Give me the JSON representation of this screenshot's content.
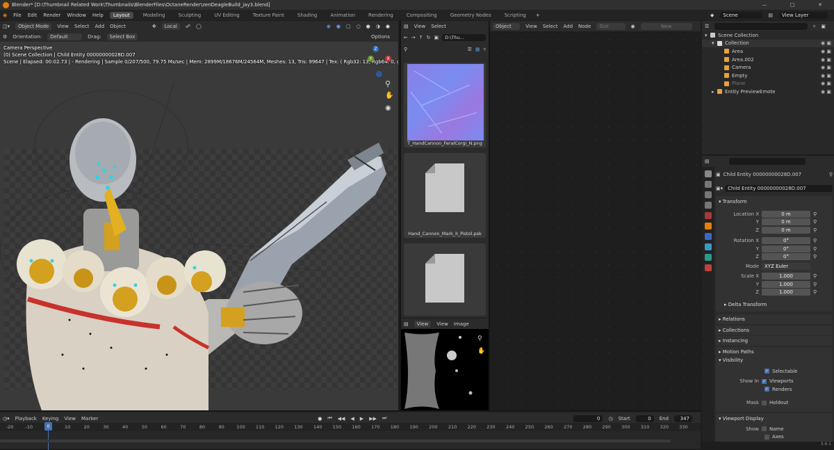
{
  "title_bar": {
    "title": "Blender* [D:\\Thumbnail Related Work\\Thumbnails\\BlenderFiles\\OctaneRender\\zenDeagleBuild_jay3.blend]"
  },
  "menu": [
    "File",
    "Edit",
    "Render",
    "Window",
    "Help"
  ],
  "workspaces": [
    "Layout",
    "Modeling",
    "Sculpting",
    "UV Editing",
    "Texture Paint",
    "Shading",
    "Animation",
    "Rendering",
    "Compositing",
    "Geometry Nodes",
    "Scripting"
  ],
  "active_workspace": "Layout",
  "scene": {
    "name": "Scene",
    "view_layer": "View Layer"
  },
  "viewport": {
    "mode": "Object Mode",
    "menus": [
      "View",
      "Select",
      "Add",
      "Object"
    ],
    "transform_orientation": "Local",
    "orientation_label": "Orientation:",
    "orientation_value": "Default",
    "drag_label": "Drag:",
    "drag_value": "Select Box",
    "options": "Options",
    "overlay_line1": "Camera Perspective",
    "overlay_line2": "(0) Scene Collection | Child Entity 00000000028D.007",
    "overlay_line3": "Scene | Elapsed: 00:02.73 |  - Rendering | Sample 0/207/500, 79.75 Ms/sec | Mem: 2899M/18676M/24564M, Meshes: 13, Tris: 99647 | Tex: ( Rgb32: 13, Rgb64: 0, grey8: 0, g... 16:... | No ne"
  },
  "file_browser": {
    "menus": [
      "View",
      "Select"
    ],
    "path": "D:\\Thu...",
    "files": [
      "T_HandCannon_FeralCorgi_N.png",
      "Hand_Cannon_Mark_II_Pistol.psk",
      ""
    ]
  },
  "image_viewer": {
    "menus": [
      "View",
      "View",
      "Image"
    ]
  },
  "node_editor": {
    "menus": [
      "Object",
      "View",
      "Select",
      "Add",
      "Node"
    ],
    "slot": "Slot",
    "new_label": "New"
  },
  "outliner": {
    "rows": [
      {
        "label": "Scene Collection",
        "indent": 0,
        "color": "#c9c9c9"
      },
      {
        "label": "Collection",
        "indent": 1,
        "color": "#dddddd"
      },
      {
        "label": "Area",
        "indent": 2,
        "color": "#e8a040"
      },
      {
        "label": "Area.002",
        "indent": 2,
        "color": "#e8a040"
      },
      {
        "label": "Camera",
        "indent": 2,
        "color": "#e8a040"
      },
      {
        "label": "Empty",
        "indent": 2,
        "color": "#e8a040"
      },
      {
        "label": "Plane",
        "indent": 2,
        "color": "#e8a040"
      },
      {
        "label": "Entity PreviewEmote",
        "indent": 1,
        "color": "#e8a040"
      }
    ]
  },
  "properties": {
    "object_name": "Child Entity 00000000028D.007",
    "datablock_name": "Child Entity 00000000028D.007",
    "transform_title": "Transform",
    "location": {
      "label": "Location X",
      "x": "0 m",
      "y": "0 m",
      "z": "0 m"
    },
    "rotation": {
      "label": "Rotation X",
      "x": "0°",
      "y": "0°",
      "z": "0°"
    },
    "mode_label": "Mode",
    "mode_value": "XYZ Euler",
    "scale": {
      "label": "Scale X",
      "x": "1.000",
      "y": "1.000",
      "z": "1.000"
    },
    "axis_y": "Y",
    "axis_z": "Z",
    "delta_transform": "Delta Transform",
    "sections": [
      "Relations",
      "Collections",
      "Instancing",
      "Motion Paths"
    ],
    "visibility_title": "Visibility",
    "selectable": "Selectable",
    "show_in_label": "Show In",
    "viewports": "Viewports",
    "renders": "Renders",
    "mask_label": "Mask",
    "holdout": "Holdout",
    "viewport_display_title": "Viewport Display",
    "show_label": "Show",
    "name_label": "Name",
    "axes_label": "Axes"
  },
  "timeline": {
    "menus": [
      "Playback",
      "Keying",
      "View",
      "Marker"
    ],
    "current_frame": "0",
    "start_label": "Start",
    "start": "0",
    "end_label": "End",
    "end": "347",
    "ticks": [
      "-20",
      "-10",
      "0",
      "10",
      "20",
      "30",
      "40",
      "50",
      "60",
      "70",
      "80",
      "90",
      "100",
      "110",
      "120",
      "130",
      "140",
      "150",
      "160",
      "170",
      "180",
      "190",
      "200",
      "210",
      "220",
      "230",
      "240",
      "250",
      "260",
      "270",
      "280",
      "290",
      "300",
      "310",
      "320",
      "330"
    ]
  },
  "version": "3.6.1"
}
